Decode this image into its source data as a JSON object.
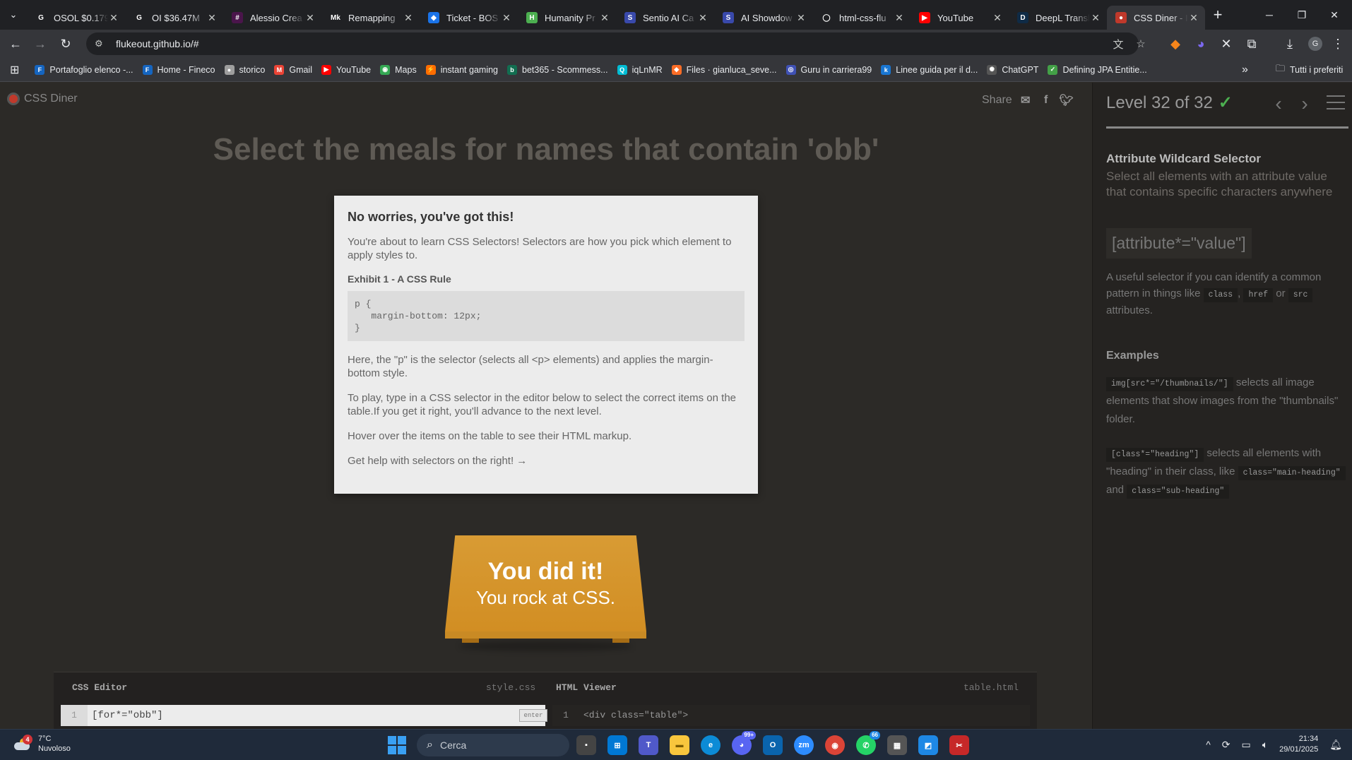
{
  "browser": {
    "tabs": [
      {
        "title": "OSOL $0.179",
        "icon": "gitbook-icon",
        "color": "#202124",
        "glyph": "G"
      },
      {
        "title": "OI $36.47M",
        "icon": "gitbook-icon",
        "color": "#202124",
        "glyph": "G"
      },
      {
        "title": "Alessio Crea",
        "icon": "slack-icon",
        "color": "#4a154b",
        "glyph": "#"
      },
      {
        "title": "Remapping",
        "icon": "mk-icon",
        "color": "#202124",
        "glyph": "Mk"
      },
      {
        "title": "Ticket - BOS",
        "icon": "ticket-icon",
        "color": "#1a73e8",
        "glyph": "◆"
      },
      {
        "title": "Humanity Pr",
        "icon": "humanity-icon",
        "color": "#4caf50",
        "glyph": "H"
      },
      {
        "title": "Sentio AI Ca",
        "icon": "sentio-icon",
        "color": "#3949ab",
        "glyph": "S"
      },
      {
        "title": "AI Showdow",
        "icon": "sentio-icon",
        "color": "#3949ab",
        "glyph": "S"
      },
      {
        "title": "html-css-flu",
        "icon": "github-icon",
        "color": "#202124",
        "glyph": "◯"
      },
      {
        "title": "YouTube",
        "icon": "youtube-icon",
        "color": "#ff0000",
        "glyph": "▶"
      },
      {
        "title": "DeepL Transl",
        "icon": "deepl-icon",
        "color": "#0f2b46",
        "glyph": "D"
      },
      {
        "title": "CSS Diner - I",
        "icon": "css-diner-icon",
        "color": "#c0392b",
        "glyph": "●"
      }
    ],
    "url": "flukeout.github.io/#",
    "bookmarks": [
      {
        "label": "Portafoglio elenco -...",
        "color": "#1565c0",
        "glyph": "F"
      },
      {
        "label": "Home - Fineco",
        "color": "#1565c0",
        "glyph": "F"
      },
      {
        "label": "storico",
        "color": "#9e9e9e",
        "glyph": "●"
      },
      {
        "label": "Gmail",
        "color": "#ea4335",
        "glyph": "M"
      },
      {
        "label": "YouTube",
        "color": "#ff0000",
        "glyph": "▶"
      },
      {
        "label": "Maps",
        "color": "#34a853",
        "glyph": "◉"
      },
      {
        "label": "instant gaming",
        "color": "#ff6d00",
        "glyph": "⚡"
      },
      {
        "label": "bet365 - Scommess...",
        "color": "#126e51",
        "glyph": "b"
      },
      {
        "label": "iqLnMR",
        "color": "#00bcd4",
        "glyph": "Q"
      },
      {
        "label": "Files · gianluca_seve...",
        "color": "#fc6d26",
        "glyph": "◆"
      },
      {
        "label": "Guru in carriera99",
        "color": "#3f51b5",
        "glyph": "◎"
      },
      {
        "label": "Linee guida per il d...",
        "color": "#1976d2",
        "glyph": "k"
      },
      {
        "label": "ChatGPT",
        "color": "#555555",
        "glyph": "✺"
      },
      {
        "label": "Defining JPA Entitie...",
        "color": "#43a047",
        "glyph": "✓"
      }
    ],
    "all_bookmarks": "Tutti i preferiti"
  },
  "game": {
    "logo": "CSS Diner",
    "share": "Share",
    "order": "Select the meals for names that contain 'obb'",
    "help": {
      "title": "No worries, you've got this!",
      "p1": "You're about to learn CSS Selectors! Selectors are how you pick which element to apply styles to.",
      "exhibit": "Exhibit 1 - A CSS Rule",
      "code": "p {\n   margin-bottom: 12px;\n}",
      "p2": "Here, the \"p\" is the selector (selects all <p> elements) and applies the margin-bottom style.",
      "p3": "To play, type in a CSS selector in the editor below to select the correct items on the table.If you get it right, you'll advance to the next level.",
      "p4": "Hover over the items on the table to see their HTML markup.",
      "p5": "Get help with selectors on the right! →"
    },
    "table": {
      "line1": "You did it!",
      "line2": "You rock at CSS."
    },
    "editor": {
      "css_title": "CSS Editor",
      "css_file": "style.css",
      "html_title": "HTML Viewer",
      "html_file": "table.html",
      "line_no": "1",
      "css_value": "[for*=\"obb\"]",
      "enter": "enter",
      "html_line": "<div class=\"table\">"
    }
  },
  "sidebar": {
    "level": "Level 32 of 32",
    "progress": 1.0,
    "selector_name": "Attribute Wildcard Selector",
    "title": "Select all elements with an attribute value that contains specific characters anywhere",
    "syntax": "[attribute*=\"value\"]",
    "hint_pre": "A useful selector if you can identify a common pattern in things like",
    "hint_tags": [
      "class",
      "href",
      "src"
    ],
    "hint_sep": ",",
    "hint_or": "or",
    "hint_post": "attributes.",
    "examples_title": "Examples",
    "ex1_code": "img[src*=\"/thumbnails/\"]",
    "ex1_text": "selects all image elements that show images from the \"thumbnails\" folder.",
    "ex2_code": "[class*=\"heading\"]",
    "ex2_text": "selects all elements with \"heading\" in their class, like",
    "ex2_code2": "class=\"main-heading\"",
    "ex2_and": "and",
    "ex2_code3": "class=\"sub-heading\""
  },
  "taskbar": {
    "weather_badge": "4",
    "temp": "7°C",
    "condition": "Nuvoloso",
    "search": "Cerca",
    "discord_badge": "99+",
    "whatsapp_badge": "66",
    "time": "21:34",
    "date": "29/01/2025"
  }
}
